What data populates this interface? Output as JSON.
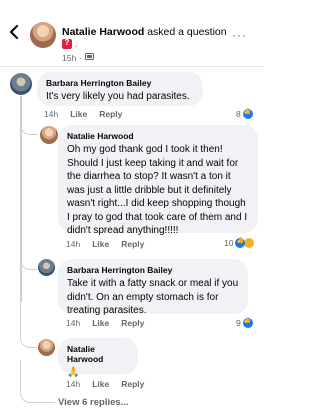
{
  "header": {
    "author": "Natalie Harwood",
    "action": "asked a question",
    "badge_suffix": ".",
    "time": "15h",
    "audience_icon": "group-icon",
    "more_label": "···"
  },
  "comments": [
    {
      "author": "Barbara Herrington Bailey",
      "text": "It's very likely you had parasites.",
      "time": "14h",
      "like_label": "Like",
      "reply_label": "Reply",
      "reaction_count": "8"
    },
    {
      "author": "Natalie Harwood",
      "text": "Oh my god thank god I took it then! Should I just keep taking it and wait for the diarrhea to stop? It wasn't a ton it was just a little dribble but it definitely wasn't right...I did keep shopping though I pray to god that took care of them and I didn't spread anything!!!!!",
      "time": "14h",
      "like_label": "Like",
      "reply_label": "Reply",
      "reaction_count": "10"
    },
    {
      "author": "Barbara Herrington Bailey",
      "text": "Take it with a fatty snack or meal if you didn't. On an empty stomach is for treating parasites.",
      "time": "14h",
      "like_label": "Like",
      "reply_label": "Reply",
      "reaction_count": "9"
    },
    {
      "author": "Natalie Harwood",
      "text": "🙏",
      "time": "14h",
      "like_label": "Like",
      "reply_label": "Reply",
      "reaction_count": ""
    }
  ],
  "view_more": "View 6 replies..."
}
